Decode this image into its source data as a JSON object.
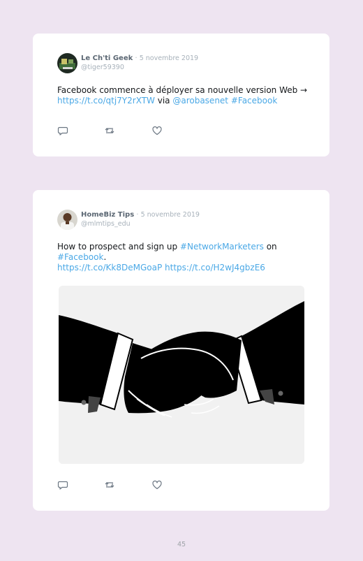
{
  "tweets": [
    {
      "author": "Le Ch'ti Geek",
      "separator": "·",
      "date": "5 novembre 2019",
      "handle": "@tiger59390",
      "text": {
        "part1": "Facebook commence à déployer sa nouvelle version Web → ",
        "link1": "https://t.co/qtj7Y2rXTW",
        "part2": " via ",
        "mention": "@arobasenet",
        "part3": " ",
        "hashtag": "#Facebook"
      }
    },
    {
      "author": "HomeBiz Tips",
      "separator": "·",
      "date": "5 novembre 2019",
      "handle": "@mlmtips_edu",
      "text": {
        "part1": "How to prospect and sign up ",
        "hashtag1": "#NetworkMarketers",
        "part2": " on ",
        "hashtag2": "#Facebook",
        "part3": ". ",
        "link1": "https://t.co/Kk8DeMGoaP",
        "part4": " ",
        "link2": "https://t.co/H2wJ4gbzE6"
      }
    }
  ],
  "icons": {
    "reply": "reply-icon",
    "retweet": "retweet-icon",
    "like": "heart-icon"
  },
  "colors": {
    "background": "#eee4f1",
    "card": "#ffffff",
    "link": "#4aa8e6",
    "text": "#14171a",
    "muted": "#a7b1ba"
  },
  "page_number": "45"
}
